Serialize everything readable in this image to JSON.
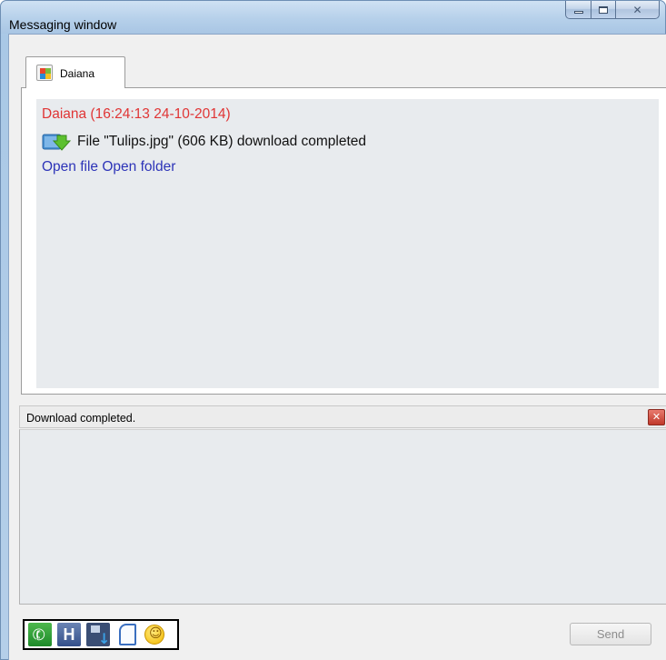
{
  "window": {
    "title": "Messaging window",
    "controls": {
      "minimize_icon": "minimize-icon",
      "maximize_icon": "maximize-icon",
      "close_icon": "close-icon"
    }
  },
  "tabs": [
    {
      "label": "Daiana",
      "icon": "windows-logo-icon",
      "active": true
    }
  ],
  "chat": {
    "message_header": "Daiana (16:24:13 24-10-2014)",
    "file_line": "File \"Tulips.jpg\" (606 KB) download completed",
    "file_icon": "download-completed-icon",
    "links": {
      "open_file": "Open file",
      "open_folder": "Open folder"
    }
  },
  "status": {
    "text": "Download completed.",
    "close_icon": "close-x-icon"
  },
  "input": {
    "value": ""
  },
  "toolbar": {
    "buttons": [
      {
        "icon": "phone-icon"
      },
      {
        "icon": "history-icon",
        "glyph": "H"
      },
      {
        "icon": "save-icon"
      },
      {
        "icon": "file-icon"
      },
      {
        "icon": "smiley-icon"
      }
    ],
    "send_label": "Send",
    "send_enabled": false
  },
  "colors": {
    "sender_name": "#e03535",
    "link": "#2d34b8",
    "chat_background": "#e8ebee",
    "send_disabled_text": "#8d8d8d"
  }
}
